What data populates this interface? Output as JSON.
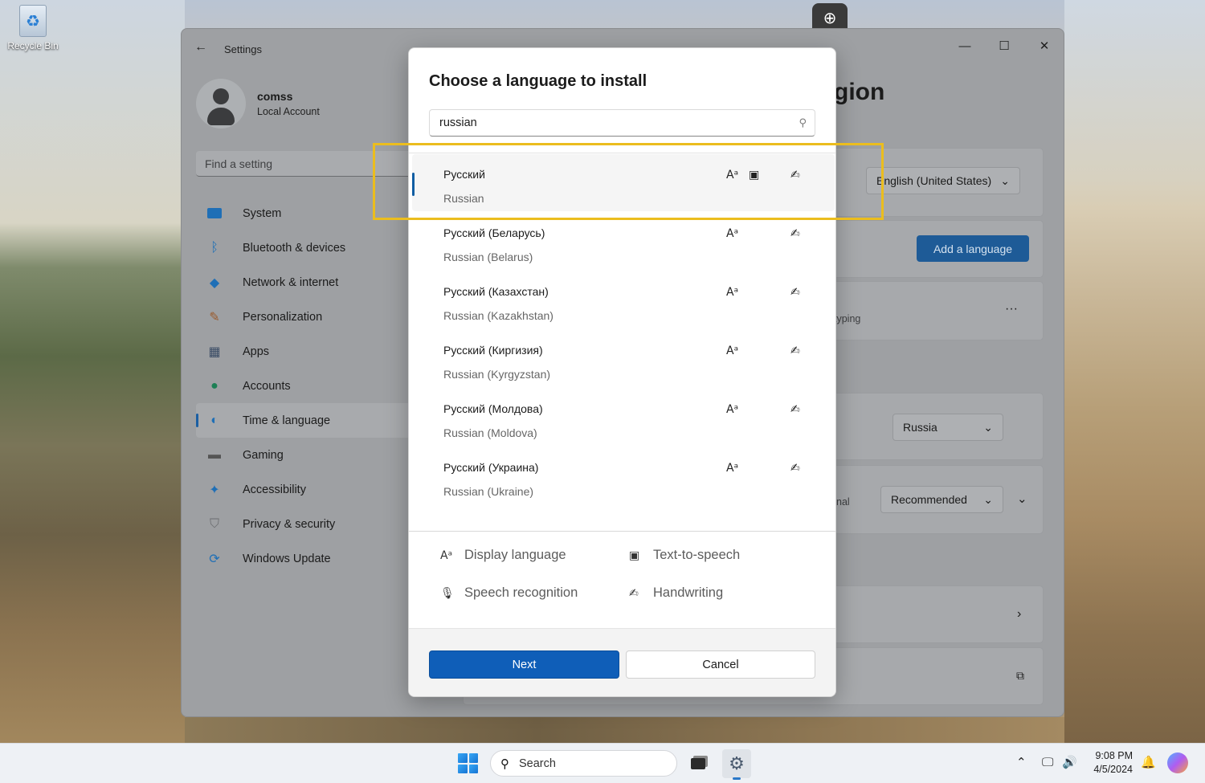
{
  "desktop": {
    "recycle_bin_label": "Recycle Bin"
  },
  "window": {
    "title": "Settings",
    "profile": {
      "name": "comss",
      "account_type": "Local Account"
    },
    "search_placeholder": "Find a setting",
    "nav": [
      {
        "label": "System",
        "icon": "monitor-icon"
      },
      {
        "label": "Bluetooth & devices",
        "icon": "bluetooth-icon"
      },
      {
        "label": "Network & internet",
        "icon": "wifi-icon"
      },
      {
        "label": "Personalization",
        "icon": "brush-icon"
      },
      {
        "label": "Apps",
        "icon": "apps-icon"
      },
      {
        "label": "Accounts",
        "icon": "person-icon"
      },
      {
        "label": "Time & language",
        "icon": "clock-globe-icon",
        "active": true
      },
      {
        "label": "Gaming",
        "icon": "gamepad-icon"
      },
      {
        "label": "Accessibility",
        "icon": "accessibility-icon"
      },
      {
        "label": "Privacy & security",
        "icon": "shield-icon"
      },
      {
        "label": "Windows Update",
        "icon": "update-icon"
      }
    ],
    "page_title_fragment": "gion",
    "display_language_value": "English (United States)",
    "add_language_label": "Add a language",
    "typing_fragment": "typing",
    "more_label": "···",
    "region_value": "Russia",
    "regional_fragment": "nal",
    "regional_format_value": "Recommended"
  },
  "dialog": {
    "title": "Choose a language to install",
    "search_value": "russian",
    "languages": [
      {
        "native": "Русский",
        "english": "Russian",
        "selected": true,
        "features": [
          "display-language",
          "text-to-speech",
          "handwriting"
        ]
      },
      {
        "native": "Русский (Беларусь)",
        "english": "Russian (Belarus)",
        "features": [
          "display-language",
          "handwriting"
        ]
      },
      {
        "native": "Русский (Казахстан)",
        "english": "Russian (Kazakhstan)",
        "features": [
          "display-language",
          "handwriting"
        ]
      },
      {
        "native": "Русский (Киргизия)",
        "english": "Russian (Kyrgyzstan)",
        "features": [
          "display-language",
          "handwriting"
        ]
      },
      {
        "native": "Русский (Молдова)",
        "english": "Russian (Moldova)",
        "features": [
          "display-language",
          "handwriting"
        ]
      },
      {
        "native": "Русский (Украина)",
        "english": "Russian (Ukraine)",
        "features": [
          "display-language",
          "handwriting"
        ]
      }
    ],
    "legend": {
      "display_language": "Display language",
      "text_to_speech": "Text-to-speech",
      "speech_recognition": "Speech recognition",
      "handwriting": "Handwriting"
    },
    "next_label": "Next",
    "cancel_label": "Cancel"
  },
  "taskbar": {
    "search_placeholder": "Search",
    "time": "9:08 PM",
    "date": "4/5/2024"
  },
  "colors": {
    "accent": "#0f5eb8",
    "highlight_box": "#ebbd1e"
  }
}
